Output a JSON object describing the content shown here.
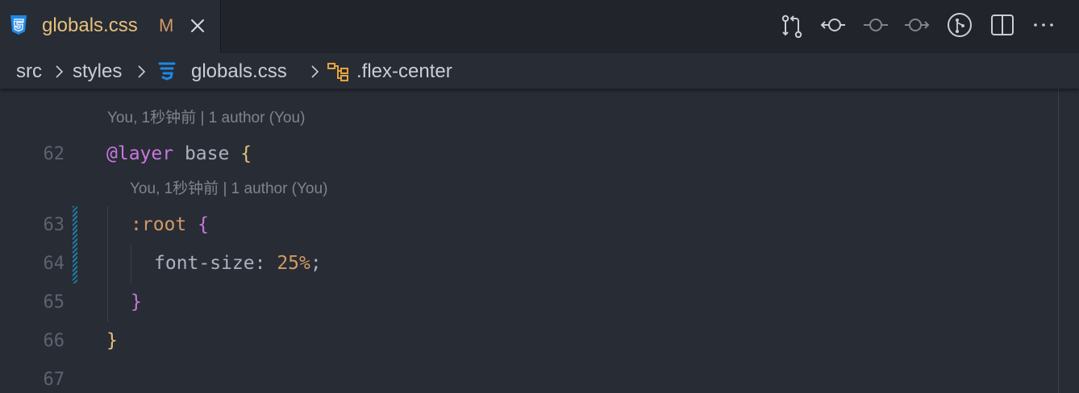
{
  "tab": {
    "title": "globals.css",
    "modified_marker": "M",
    "icon": "css-file-icon"
  },
  "actions": [
    "compare-changes-icon",
    "previous-change-icon",
    "commit-timeline-icon",
    "next-change-icon",
    "source-control-graph-icon",
    "split-editor-icon",
    "more-actions-icon"
  ],
  "breadcrumb": {
    "items": [
      "src",
      "styles",
      "globals.css",
      ".flex-center"
    ]
  },
  "editor": {
    "codelens_1": "You, 1秒钟前 | 1 author (You)",
    "codelens_2": "You, 1秒钟前 | 1 author (You)",
    "lines": [
      {
        "num": "62",
        "at_kw": "@layer",
        "name": " base ",
        "brace": "{"
      },
      {
        "num": "63",
        "selector": ":root",
        "space": " ",
        "brace": "{"
      },
      {
        "num": "64",
        "prop": "font-size",
        "colon": ": ",
        "value": "25%",
        "semi": ";"
      },
      {
        "num": "65",
        "brace": "}"
      },
      {
        "num": "66",
        "brace": "}"
      },
      {
        "num": "67"
      }
    ]
  },
  "colors": {
    "background": "#282c34",
    "keyword": "#c678dd",
    "number": "#d19a66",
    "brace_outer": "#e5c07b",
    "brace_inner": "#c678dd",
    "git_modified": "#1b7eaa"
  }
}
